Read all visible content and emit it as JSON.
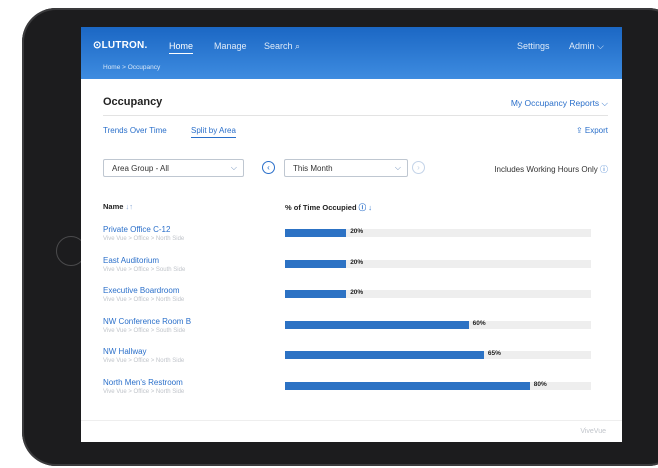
{
  "header": {
    "logo": "⊙LUTRON.",
    "nav": [
      {
        "label": "Home",
        "active": true
      },
      {
        "label": "Manage",
        "active": false
      },
      {
        "label": "Search ⌕",
        "active": false
      }
    ],
    "settings": "Settings",
    "admin": "Admin ⌵",
    "breadcrumb": "Home  >  Occupancy"
  },
  "page": {
    "title": "Occupancy",
    "reports": "My Occupancy Reports ⌵",
    "tabs": [
      {
        "label": "Trends Over Time",
        "active": false
      },
      {
        "label": "Split by Area",
        "active": true
      }
    ],
    "export": "⇪ Export"
  },
  "filters": {
    "area_group": "Area Group - All",
    "period": "This Month",
    "prev_icon": "‹",
    "next_icon": "›",
    "hours_note": "Includes Working Hours Only",
    "info_icon": "ⓘ"
  },
  "table": {
    "name_header": "Name",
    "name_sort": "↓↑",
    "value_header": "% of Time Occupied",
    "value_sort": "↓",
    "rows": [
      {
        "name": "Private Office C-12",
        "path": "Vive Vue > Office > North Side",
        "percent": 20,
        "label": "20%"
      },
      {
        "name": "East Auditorium",
        "path": "Vive Vue > Office > South Side",
        "percent": 20,
        "label": "20%"
      },
      {
        "name": "Executive Boardroom",
        "path": "Vive Vue > Office > North Side",
        "percent": 20,
        "label": "20%"
      },
      {
        "name": "NW Conference Room B",
        "path": "Vive Vue > Office > South Side",
        "percent": 60,
        "label": "60%"
      },
      {
        "name": "NW Hallway",
        "path": "Vive Vue > Office > North Side",
        "percent": 65,
        "label": "65%"
      },
      {
        "name": "North Men's Restroom",
        "path": "Vive Vue > Office > North Side",
        "percent": 80,
        "label": "80%"
      }
    ]
  },
  "footer": {
    "brand": "ViveVue"
  },
  "colors": {
    "accent": "#2a6fca",
    "bar": "#2c72c4"
  }
}
